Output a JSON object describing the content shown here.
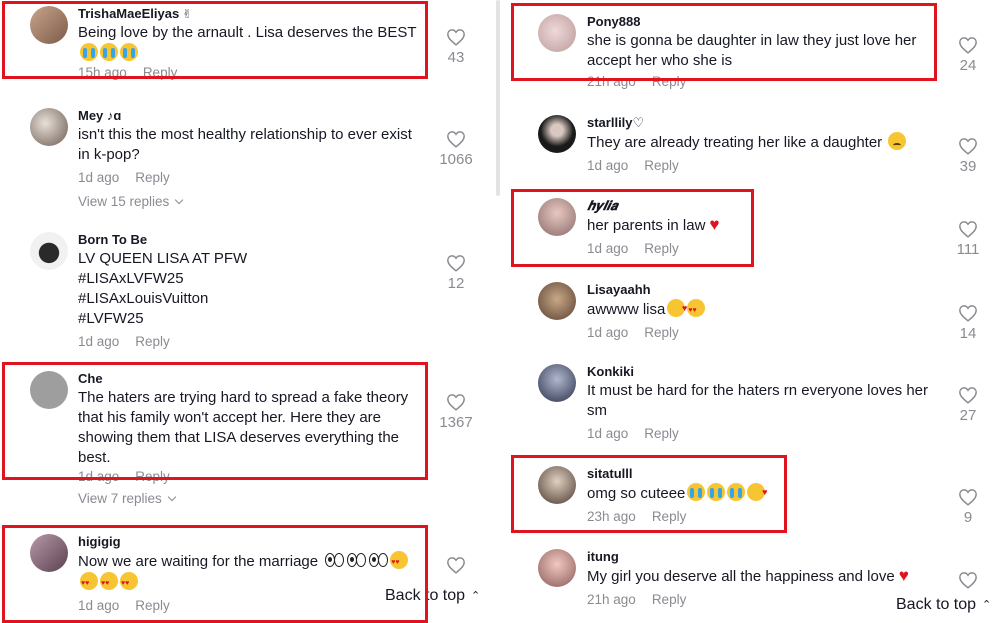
{
  "left": {
    "comments": [
      {
        "user": "TrishaMaeEliyas",
        "user_suffix": "✌",
        "lines": [
          "Being love by the arnault . Lisa deserves the BEST"
        ],
        "emoji_line": "crying x3",
        "time": "15h ago",
        "reply": "Reply",
        "likes": "43"
      },
      {
        "user": "Mey",
        "user_suffix": "♪ɑ",
        "lines": [
          "isn't this the most healthy relationship to ever exist",
          "in k-pop?"
        ],
        "time": "1d ago",
        "reply": "Reply",
        "likes": "1066",
        "view_replies": "View 15 replies"
      },
      {
        "user": "Born To Be",
        "lines": [
          "LV QUEEN LISA AT PFW",
          "#LISAxLVFW25",
          "#LISAxLouisVuitton",
          "#LVFW25"
        ],
        "time": "1d ago",
        "reply": "Reply",
        "likes": "12"
      },
      {
        "user": "Che",
        "lines": [
          "The haters are trying hard to spread a fake theory",
          "that his family won't accept her. Here they are",
          "showing them that LISA deserves everything the",
          "best."
        ],
        "time": "1d ago",
        "reply": "Reply",
        "likes": "1367",
        "view_replies": "View 7 replies"
      },
      {
        "user": "higigig",
        "lines": [
          "Now we are waiting for the marriage"
        ],
        "time": "1d ago",
        "reply": "Reply",
        "likes": ""
      }
    ],
    "back_to_top": "Back to top"
  },
  "right": {
    "comments": [
      {
        "user": "Pony888",
        "lines": [
          "she is gonna be daughter in law they just love her",
          "accept her who she is"
        ],
        "time": "21h ago",
        "reply": "Reply",
        "likes": "24"
      },
      {
        "user": "starllily♡",
        "lines": [
          "They are already treating her like a daughter"
        ],
        "time": "1d ago",
        "reply": "Reply",
        "likes": "39"
      },
      {
        "user": "𝒉𝒚𝒍𝒊𝒂",
        "lines": [
          "her parents in law"
        ],
        "time": "1d ago",
        "reply": "Reply",
        "likes": "111"
      },
      {
        "user": "Lisayaahh",
        "lines": [
          "awwww lisa"
        ],
        "time": "1d ago",
        "reply": "Reply",
        "likes": "14"
      },
      {
        "user": "Konkiki",
        "lines": [
          "It must be hard for the haters rn everyone loves her",
          "sm"
        ],
        "time": "1d ago",
        "reply": "Reply",
        "likes": "27"
      },
      {
        "user": "sitatulll",
        "lines": [
          "omg so cuteee"
        ],
        "time": "23h ago",
        "reply": "Reply",
        "likes": "9"
      },
      {
        "user": "itung",
        "lines": [
          "My girl you deserve all the happiness and love"
        ],
        "time": "21h ago",
        "reply": "Reply",
        "likes": ""
      }
    ],
    "back_to_top": "Back to top"
  },
  "colors": {
    "highlight": "#e0141e",
    "muted": "#8a8b91",
    "text": "#161823"
  }
}
